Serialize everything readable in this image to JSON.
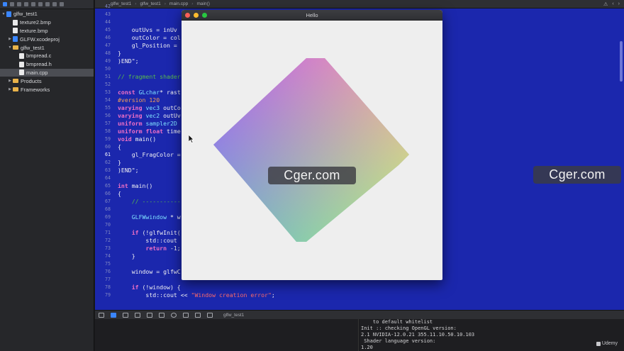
{
  "navigator": {
    "items": [
      {
        "label": "glfw_test1",
        "kind": "project",
        "depth": 0,
        "arrow": "▼",
        "selected": false
      },
      {
        "label": "texture2.bmp",
        "kind": "file",
        "depth": 1,
        "arrow": "",
        "selected": false
      },
      {
        "label": "texture.bmp",
        "kind": "file",
        "depth": 1,
        "arrow": "",
        "selected": false
      },
      {
        "label": "GLFW.xcodeproj",
        "kind": "project",
        "depth": 1,
        "arrow": "▶",
        "selected": false
      },
      {
        "label": "glfw_test1",
        "kind": "folder",
        "depth": 1,
        "arrow": "▼",
        "selected": false
      },
      {
        "label": "bmpread.c",
        "kind": "file",
        "depth": 2,
        "arrow": "",
        "selected": false
      },
      {
        "label": "bmpread.h",
        "kind": "file",
        "depth": 2,
        "arrow": "",
        "selected": false
      },
      {
        "label": "main.cpp",
        "kind": "file",
        "depth": 2,
        "arrow": "",
        "selected": true
      },
      {
        "label": "Products",
        "kind": "folder",
        "depth": 1,
        "arrow": "▶",
        "selected": false
      },
      {
        "label": "Frameworks",
        "kind": "folder",
        "depth": 1,
        "arrow": "▶",
        "selected": false
      }
    ]
  },
  "jump_bar": {
    "crumbs": [
      "glfw_test1",
      "glfw_test1",
      "main.cpp",
      "main()"
    ]
  },
  "editor": {
    "current_line": "61",
    "lines": [
      {
        "no": "42",
        "text": ""
      },
      {
        "no": "43",
        "text": ""
      },
      {
        "no": "44",
        "text": ""
      },
      {
        "no": "45",
        "text": "    outUvs = inUv"
      },
      {
        "no": "46",
        "text": "    outColor = col"
      },
      {
        "no": "47",
        "text": "    gl_Position = "
      },
      {
        "no": "48",
        "text": "}"
      },
      {
        "no": "49",
        "text": ")END\";"
      },
      {
        "no": "50",
        "text": ""
      },
      {
        "no": "51",
        "text": "// fragment shader"
      },
      {
        "no": "52",
        "text": ""
      },
      {
        "no": "53",
        "text": "const GLchar* rast"
      },
      {
        "no": "54",
        "text": "#version 120"
      },
      {
        "no": "55",
        "text": "varying vec3 outCo"
      },
      {
        "no": "56",
        "text": "varying vec2 outUv"
      },
      {
        "no": "57",
        "text": "uniform sampler2D "
      },
      {
        "no": "58",
        "text": "uniform float time"
      },
      {
        "no": "59",
        "text": "void main()"
      },
      {
        "no": "60",
        "text": "{"
      },
      {
        "no": "61",
        "text": "    gl_FragColor = "
      },
      {
        "no": "62",
        "text": "}"
      },
      {
        "no": "63",
        "text": ")END\";"
      },
      {
        "no": "64",
        "text": ""
      },
      {
        "no": "65",
        "text": "int main()"
      },
      {
        "no": "66",
        "text": "{"
      },
      {
        "no": "67",
        "text": "    // -----------"
      },
      {
        "no": "68",
        "text": ""
      },
      {
        "no": "69",
        "text": "    GLFWwindow * w"
      },
      {
        "no": "70",
        "text": ""
      },
      {
        "no": "71",
        "text": "    if (!glfwInit("
      },
      {
        "no": "72",
        "text": "        std::cout "
      },
      {
        "no": "73",
        "text": "        return -1;"
      },
      {
        "no": "74",
        "text": "    }"
      },
      {
        "no": "75",
        "text": ""
      },
      {
        "no": "76",
        "text": "    window = glfwCreateWindow(    ,    ,       ,    );"
      },
      {
        "no": "77",
        "text": ""
      },
      {
        "no": "78",
        "text": "    if (!window) {"
      },
      {
        "no": "79",
        "text": "        std::cout << \"Window creation error\";"
      }
    ]
  },
  "debug_bar": {
    "target": "glfw_test1"
  },
  "console": {
    "lines": [
      "    to default whitelist",
      "Init :: checking OpenGL version:",
      "2.1 NVIDIA-12.0.21 355.11.10.50.10.103",
      " Shader language version:",
      "1.20"
    ]
  },
  "gl_window": {
    "title": "Hello",
    "colors": {
      "close": "#fe5f57",
      "minimize": "#febc2e",
      "zoom": "#28c840"
    },
    "quad_colors": {
      "top": "#f04cf0",
      "right": "#f8f45a",
      "bottom": "#58f7a8",
      "left": "#7b6df4"
    }
  },
  "watermarks": [
    "Cger.com",
    "Cger.com"
  ],
  "branding": {
    "udemy": "Udemy"
  },
  "colors": {
    "editor_background": "#1b27ad",
    "keyword": "#f06fc6",
    "comment": "#56b94d",
    "preprocessor": "#f19d5a",
    "string": "#ff6b6b"
  }
}
